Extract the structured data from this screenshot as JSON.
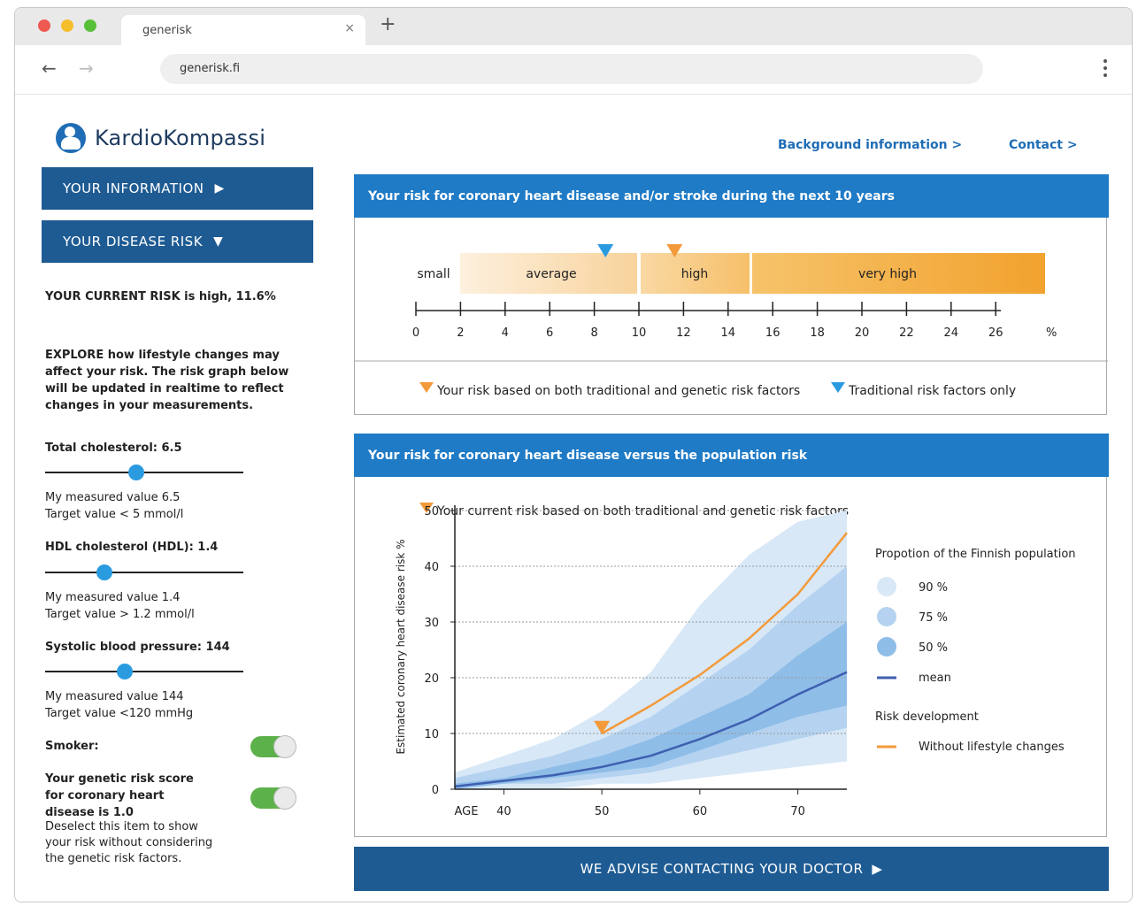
{
  "browser": {
    "tab_title": "generisk",
    "tab_close": "×",
    "new_tab": "+",
    "url": "generisk.fi",
    "back": "←",
    "forward": "→"
  },
  "site": {
    "logo_text": "KardioKompassi",
    "links": {
      "background": "Background information >",
      "contact": "Contact >"
    }
  },
  "sidebar": {
    "btn_info": "YOUR INFORMATION",
    "btn_risk": "YOUR DISEASE RISK",
    "arrow_right": "▶",
    "arrow_down": "▼",
    "current_risk": "YOUR CURRENT RISK is high, 11.6%",
    "explore_lines": [
      "EXPLORE how lifestyle changes may",
      "affect your risk. The risk graph below",
      "will be updated in realtime to reflect",
      "changes in your measurements."
    ],
    "controls": [
      {
        "title": "Total cholesterol: 6.5",
        "line1": "My measured value 6.5",
        "line2": "Target value < 5 mmol/l",
        "level": 0.46
      },
      {
        "title": "HDL cholesterol (HDL): 1.4",
        "line1": "My measured value 1.4",
        "line2": "Target value > 1.2 mmol/l",
        "level": 0.3
      },
      {
        "title": "Systolic blood pressure: 144",
        "line1": "My measured value 144",
        "line2": "Target value <120 mmHg",
        "level": 0.4
      }
    ],
    "smoker_label": "Smoker:",
    "genetic_lines": [
      "Your genetic risk score",
      "for coronary heart",
      "disease is 1.0"
    ],
    "genetic_note_lines": [
      "Deselect this item to show",
      "your risk without considering",
      "the genetic risk factors."
    ]
  },
  "panel1": {
    "header": "Your risk for coronary heart disease and/or stroke during the next 10 years",
    "bands": [
      "small",
      "average",
      "high",
      "very high"
    ],
    "ticks": [
      "0",
      "2",
      "4",
      "6",
      "8",
      "10",
      "12",
      "14",
      "16",
      "18",
      "20",
      "22",
      "24",
      "26",
      "%"
    ],
    "legend_genetic": "Your risk based on both traditional and genetic risk factors",
    "legend_traditional": "Traditional risk factors only",
    "marker_traditional": 8.5,
    "marker_genetic": 11.6
  },
  "panel2": {
    "header": "Your risk for coronary heart disease versus the population risk",
    "current_label": "Your current risk based on both traditional and genetic risk factors"
  },
  "chart_data": {
    "type": "area",
    "ylabel": "Estimated coronary heart disease risk %",
    "xlabel": "AGE",
    "x_ticks": [
      "40",
      "50",
      "60",
      "70"
    ],
    "y_ticks": [
      "0",
      "10",
      "20",
      "30",
      "40",
      "50"
    ],
    "xlim": [
      35,
      75
    ],
    "ylim": [
      0,
      50
    ],
    "x": [
      35,
      40,
      45,
      50,
      55,
      60,
      65,
      70,
      75
    ],
    "series": [
      {
        "name": "90 %",
        "upper": [
          3,
          6,
          9,
          14,
          21,
          33,
          42,
          48,
          50
        ],
        "lower": [
          0,
          0,
          0,
          1,
          1,
          2,
          3,
          4,
          5
        ]
      },
      {
        "name": "75 %",
        "upper": [
          2,
          4,
          6,
          9,
          13,
          19,
          25,
          33,
          40
        ],
        "lower": [
          0,
          1,
          1,
          2,
          3,
          5,
          7,
          9,
          11
        ]
      },
      {
        "name": "50 %",
        "upper": [
          1,
          2,
          4,
          6,
          9,
          13,
          17,
          24,
          30
        ],
        "lower": [
          0,
          1,
          2,
          3,
          4,
          7,
          10,
          13,
          15
        ]
      },
      {
        "name": "mean",
        "values": [
          0.5,
          1.5,
          2.5,
          4,
          6,
          9,
          12.5,
          17,
          21
        ]
      },
      {
        "name": "Without lifestyle changes",
        "x": [
          50,
          55,
          60,
          65,
          70,
          75
        ],
        "values": [
          10,
          15,
          20.5,
          27,
          35,
          46
        ]
      }
    ],
    "current_point": {
      "x": 50,
      "y": 11
    },
    "legend_title": "Propotion of the Finnish population",
    "legend_items": [
      "90 %",
      "75 %",
      "50 %",
      "mean"
    ],
    "legend_title2": "Risk development",
    "legend_item_orange": "Without lifestyle changes",
    "colors": {
      "p90": "#d8e8f7",
      "p75": "#b5d3f0",
      "p50": "#8ebde8",
      "mean": "#3f5fb0",
      "orange": "#f39a3b"
    }
  },
  "cta": {
    "label": "WE ADVISE CONTACTING YOUR DOCTOR",
    "arrow": "▶"
  },
  "colors": {
    "brand_dark": "#1e5b93",
    "header_blue": "#1f7bc6",
    "orange": "#f39a3b",
    "toggle_green": "#5db14a",
    "slider_blue": "#2b9be0"
  }
}
